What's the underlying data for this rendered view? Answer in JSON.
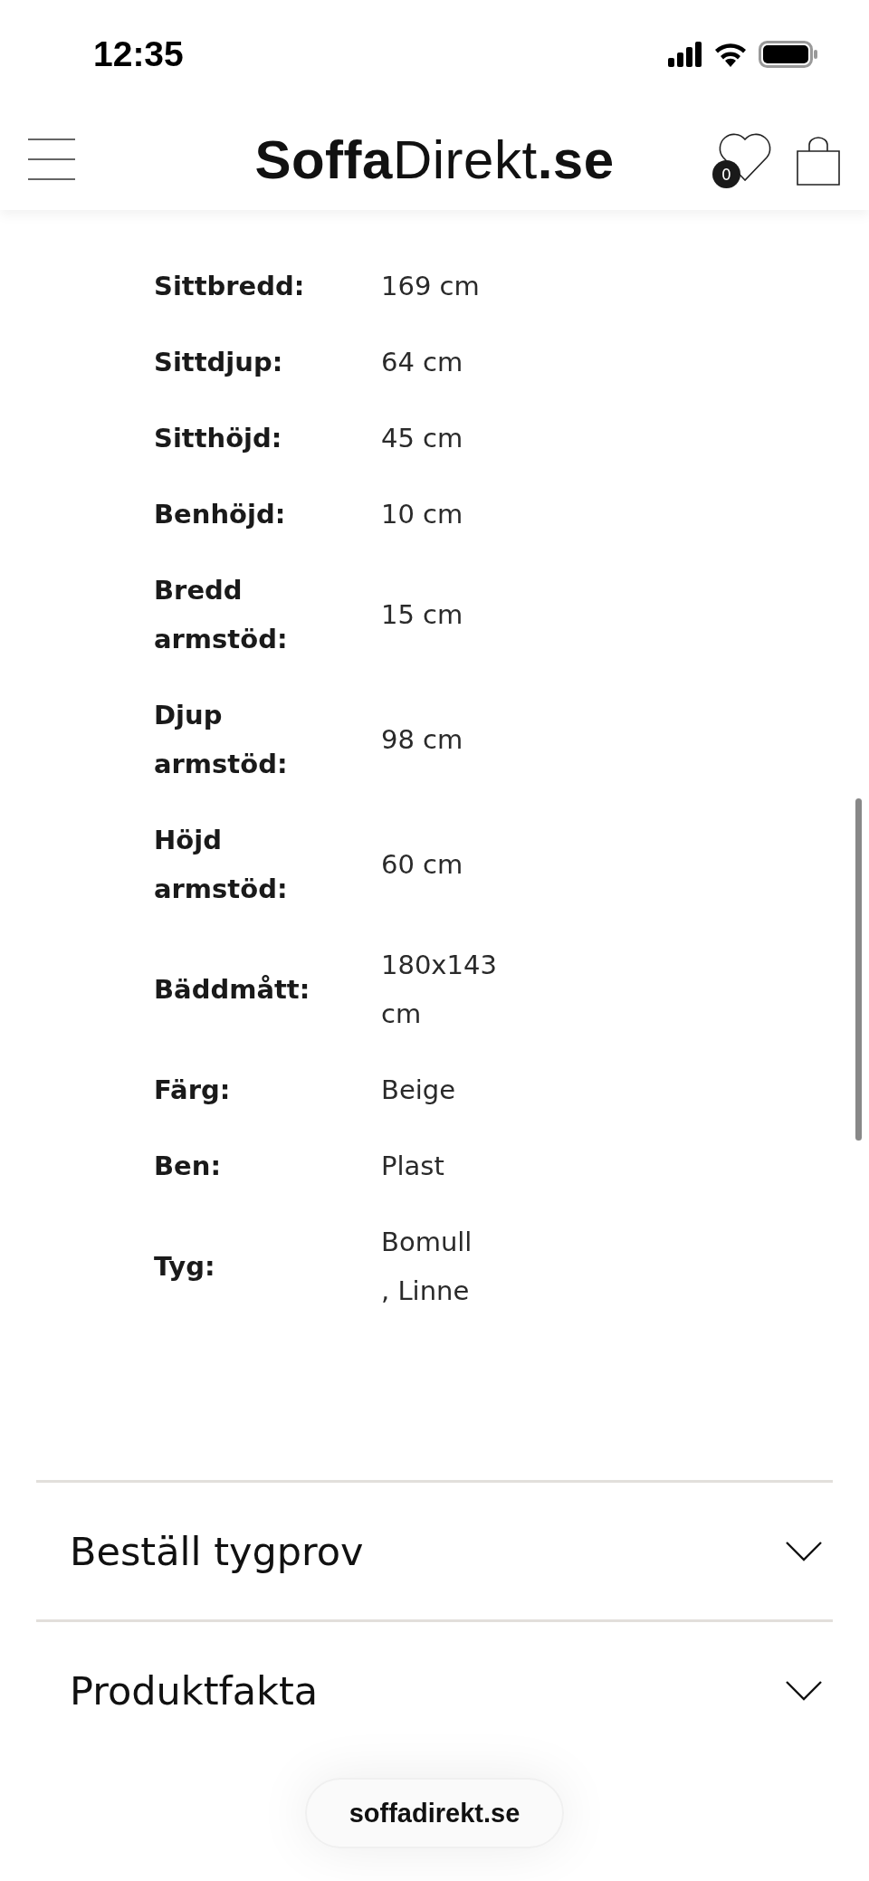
{
  "status_bar": {
    "time": "12:35"
  },
  "header": {
    "logo": "**Soffa**Direkt**.se**",
    "wishlist_count": "0"
  },
  "specs": [
    {
      "label": "Sittbredd:",
      "value": "169 cm"
    },
    {
      "label": "Sittdjup:",
      "value": "64 cm"
    },
    {
      "label": "Sitthöjd:",
      "value": "45 cm"
    },
    {
      "label": "Benhöjd:",
      "value": "10 cm"
    },
    {
      "label": "Bredd\narmstöd:",
      "value": "15 cm"
    },
    {
      "label": "Djup\narmstöd:",
      "value": "98 cm"
    },
    {
      "label": "Höjd\narmstöd:",
      "value": "60 cm"
    },
    {
      "label": "Bäddmått:",
      "value": "180x143\ncm"
    },
    {
      "label": "Färg:",
      "value": "Beige"
    },
    {
      "label": "Ben:",
      "value": "Plast"
    },
    {
      "label": "Tyg:",
      "value": "Bomull\n, Linne"
    }
  ],
  "accordion": [
    {
      "title": "Beställ tygprov",
      "expanded": false
    },
    {
      "title": "Produktfakta",
      "expanded": false
    }
  ],
  "url_bar": {
    "domain": "soffadirekt.se"
  }
}
